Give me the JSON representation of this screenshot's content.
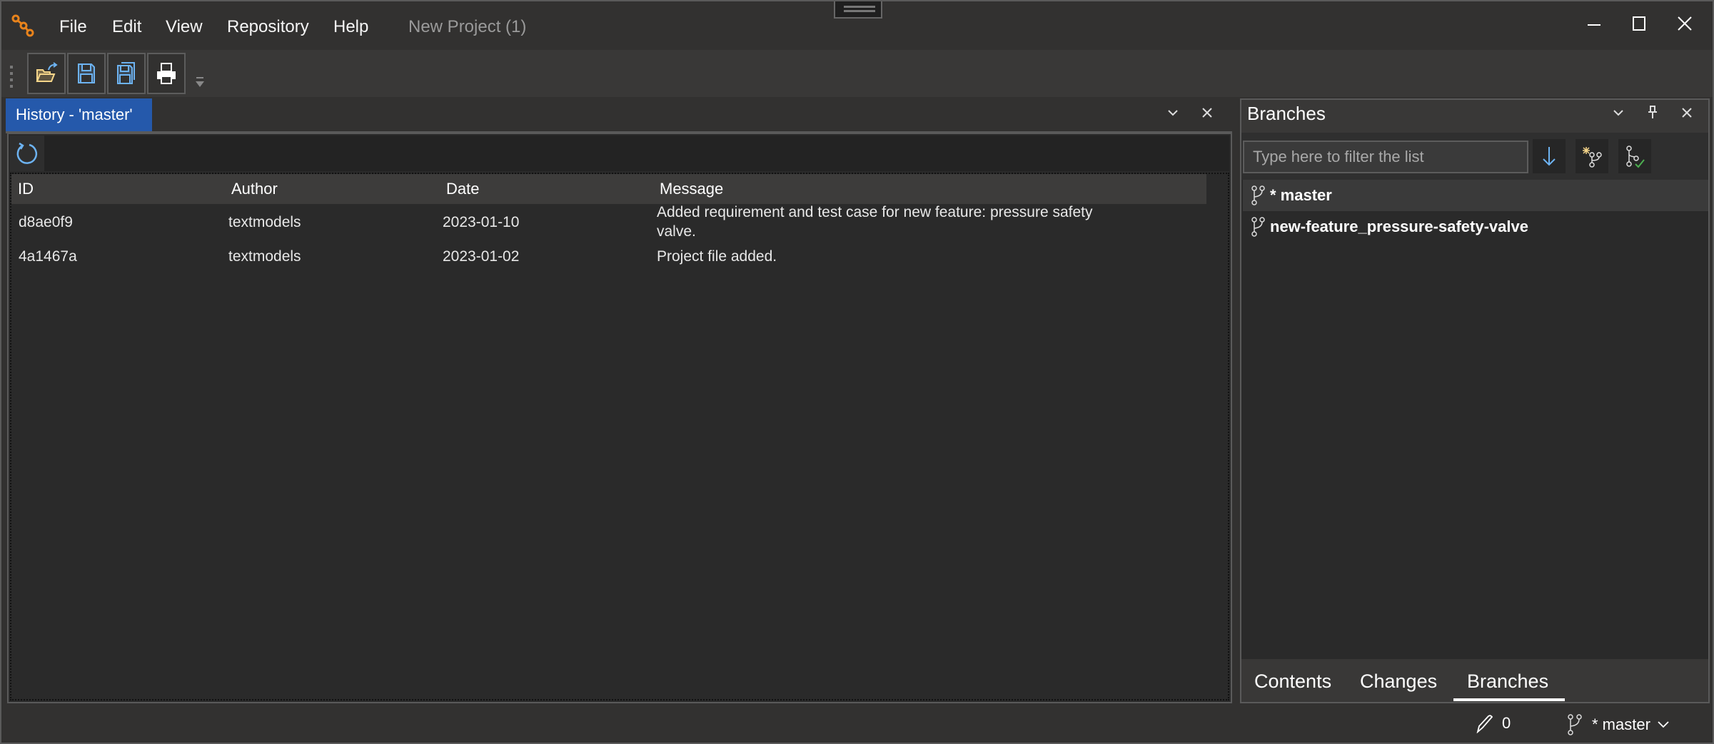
{
  "app": {
    "menu": [
      "File",
      "Edit",
      "View",
      "Repository",
      "Help"
    ],
    "project_title": "New Project (1)",
    "logo_color": "#e8831c",
    "window_controls": {
      "minimize": "–",
      "maximize": "☐",
      "close": "✕"
    }
  },
  "toolbar": {
    "buttons": [
      {
        "name": "open-project",
        "icon": "folder-open-icon"
      },
      {
        "name": "save",
        "icon": "save-icon"
      },
      {
        "name": "save-all",
        "icon": "save-all-icon"
      },
      {
        "name": "print",
        "icon": "printer-icon"
      }
    ]
  },
  "history": {
    "tab_label": "History - 'master'",
    "accent": "#2559ab",
    "columns": [
      "ID",
      "Author",
      "Date",
      "Message"
    ],
    "rows": [
      {
        "id": "d8ae0f9",
        "author": "textmodels",
        "date": "2023-01-10",
        "message_line1": "Added requirement and test case for new feature: pressure safety",
        "message_line2": "valve."
      },
      {
        "id": "4a1467a",
        "author": "textmodels",
        "date": "2023-01-02",
        "message_line1": "Project file added.",
        "message_line2": ""
      }
    ]
  },
  "branches": {
    "title": "Branches",
    "filter_placeholder": "Type here to filter the list",
    "items": [
      {
        "label": "* master",
        "selected": true
      },
      {
        "label": "new-feature_pressure-safety-valve",
        "selected": false
      }
    ],
    "tabs": [
      "Contents",
      "Changes",
      "Branches"
    ],
    "active_tab": "Branches"
  },
  "status_bar": {
    "changes_count": "0",
    "current_branch": "* master"
  }
}
